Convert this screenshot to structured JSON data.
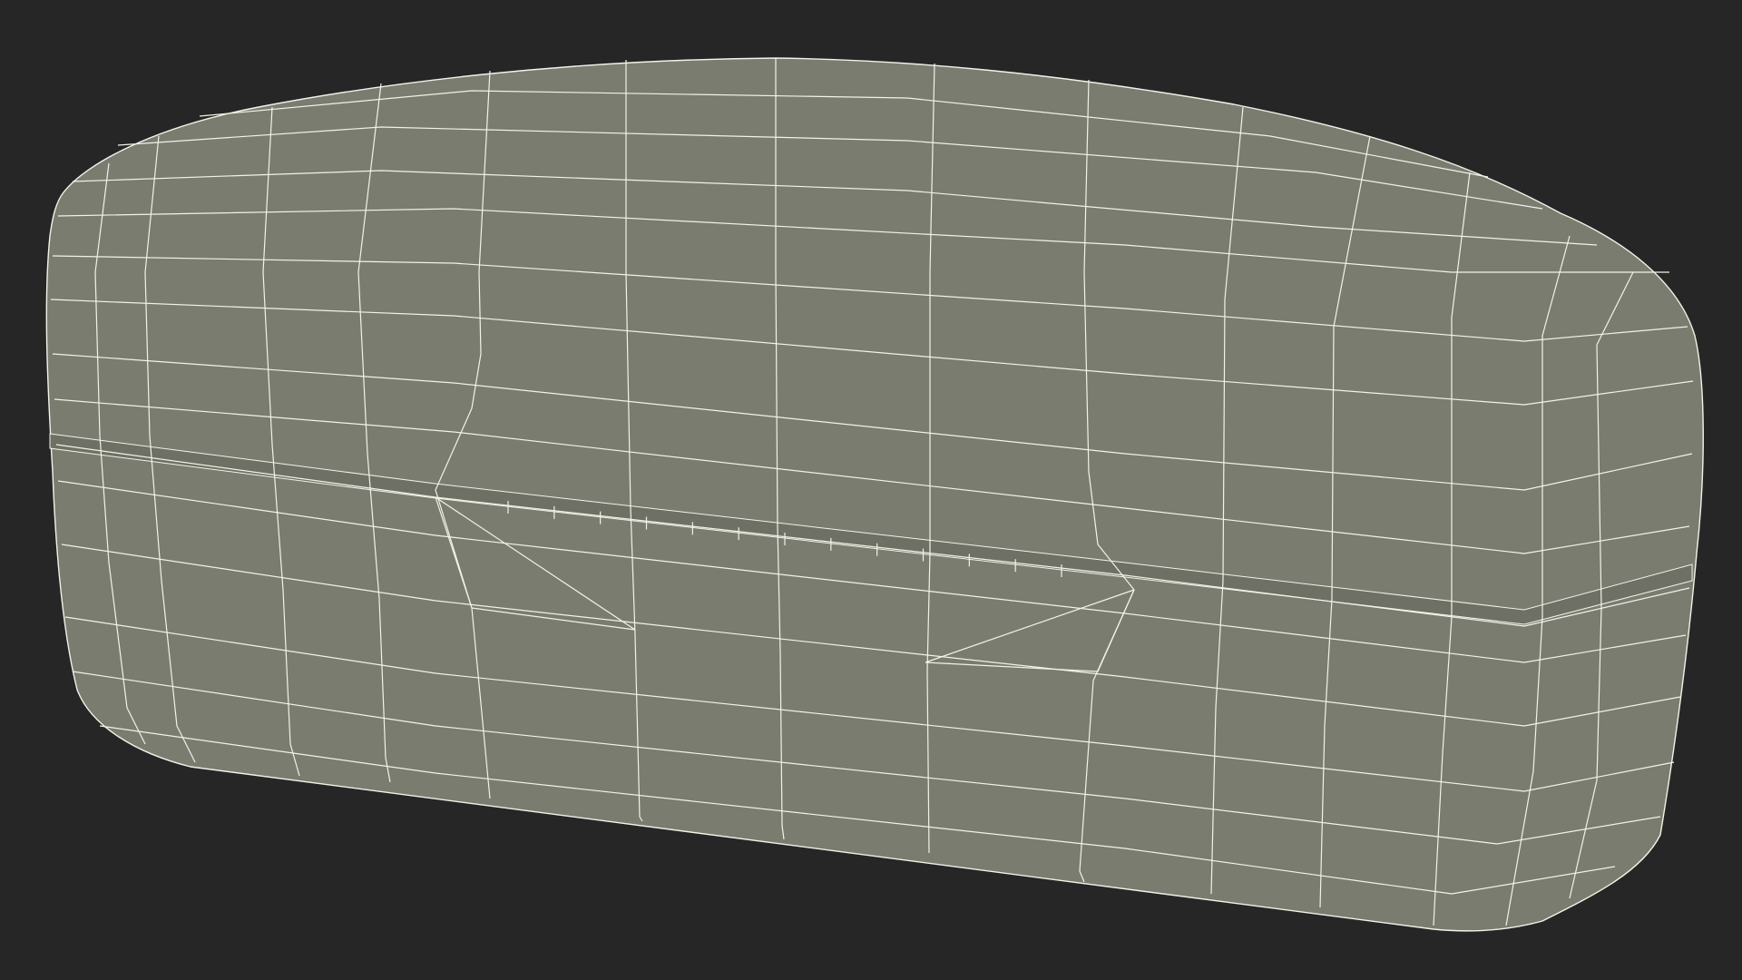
{
  "scene": {
    "subject": "wireframe-case-model",
    "background_color": "#262626",
    "surface_color": "#7b7c70",
    "shade_color": "#6f7065",
    "wire_color": "#f2f2e8"
  }
}
